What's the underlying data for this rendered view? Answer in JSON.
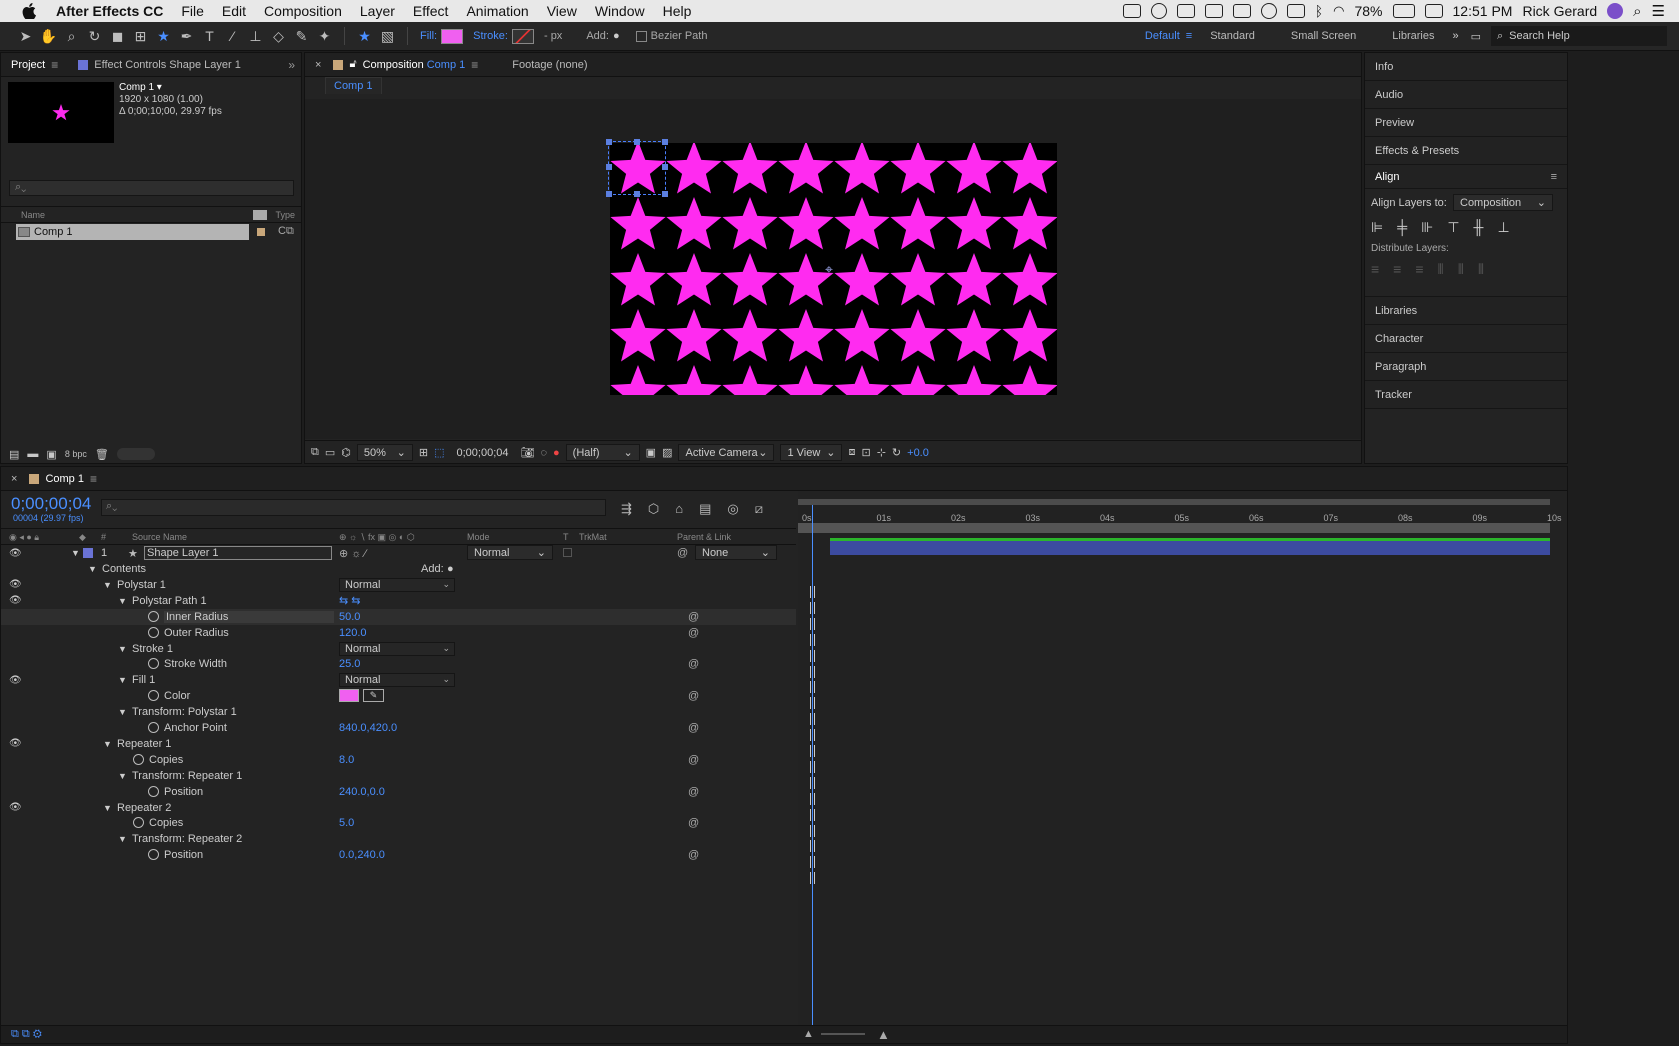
{
  "menubar": {
    "app_name": "After Effects CC",
    "menus": [
      "File",
      "Edit",
      "Composition",
      "Layer",
      "Effect",
      "Animation",
      "View",
      "Window",
      "Help"
    ],
    "battery": "78%",
    "clock": "12:51 PM",
    "user": "Rick Gerard"
  },
  "toolbar": {
    "fill_label": "Fill:",
    "stroke_label": "Stroke:",
    "stroke_units": "- px",
    "add_label": "Add:",
    "bezier_label": "Bezier Path",
    "workspaces": [
      "Default",
      "Standard",
      "Small Screen",
      "Libraries"
    ],
    "active_workspace": "Default",
    "search_help": "Search Help",
    "fill_color": "#f060f0"
  },
  "project": {
    "tab_project": "Project",
    "tab_effect_controls": "Effect Controls Shape Layer 1",
    "comp_name": "Comp 1 ▾",
    "comp_size": "1920 x 1080 (1.00)",
    "comp_duration": "Δ 0;00;10;00, 29.97 fps",
    "col_name": "Name",
    "col_type": "Type",
    "item_name": "Comp 1",
    "bpc": "8 bpc"
  },
  "composition": {
    "tab_label": "Composition",
    "tab_comp": "Comp 1",
    "tab_footage": "Footage (none)",
    "subtab": "Comp 1",
    "zoom": "50%",
    "timecode": "0;00;00;04",
    "resolution": "(Half)",
    "camera": "Active Camera",
    "views": "1 View",
    "exposure": "+0.0",
    "star_color": "#ff2bf0"
  },
  "right_panel": {
    "items": [
      "Info",
      "Audio",
      "Preview",
      "Effects & Presets"
    ],
    "align_title": "Align",
    "align_layers_to_label": "Align Layers to:",
    "align_layers_to_value": "Composition",
    "distribute_label": "Distribute Layers:",
    "more_items": [
      "Libraries",
      "Character",
      "Paragraph",
      "Tracker"
    ]
  },
  "timeline": {
    "tab": "Comp 1",
    "timecode": "0;00;00;04",
    "frames": "00004 (29.97 fps)",
    "headers": {
      "num": "#",
      "source": "Source Name",
      "mode": "Mode",
      "t": "T",
      "trkmat": "TrkMat",
      "parent": "Parent & Link"
    },
    "layer": {
      "index": "1",
      "name": "Shape Layer 1",
      "mode": "Normal",
      "parent": "None"
    },
    "add_label": "Add:",
    "rows": [
      {
        "label": "Contents"
      },
      {
        "label": "Polystar 1",
        "mode": "Normal"
      },
      {
        "label": "Polystar Path 1"
      },
      {
        "label": "Inner Radius",
        "value": "50.0"
      },
      {
        "label": "Outer Radius",
        "value": "120.0"
      },
      {
        "label": "Stroke 1",
        "mode": "Normal"
      },
      {
        "label": "Stroke Width",
        "value": "25.0"
      },
      {
        "label": "Fill 1",
        "mode": "Normal"
      },
      {
        "label": "Color"
      },
      {
        "label": "Transform: Polystar 1"
      },
      {
        "label": "Anchor Point",
        "value": "840.0,420.0"
      },
      {
        "label": "Repeater 1"
      },
      {
        "label": "Copies",
        "value": "8.0"
      },
      {
        "label": "Transform: Repeater 1"
      },
      {
        "label": "Position",
        "value": "240.0,0.0"
      },
      {
        "label": "Repeater 2"
      },
      {
        "label": "Copies",
        "value": "5.0"
      },
      {
        "label": "Transform: Repeater 2"
      },
      {
        "label": "Position",
        "value": "0.0,240.0"
      }
    ],
    "ruler": [
      "0s",
      "01s",
      "02s",
      "03s",
      "04s",
      "05s",
      "06s",
      "07s",
      "08s",
      "09s",
      "10s"
    ],
    "fill_color": "#f060f0",
    "playhead_frame": 4
  }
}
